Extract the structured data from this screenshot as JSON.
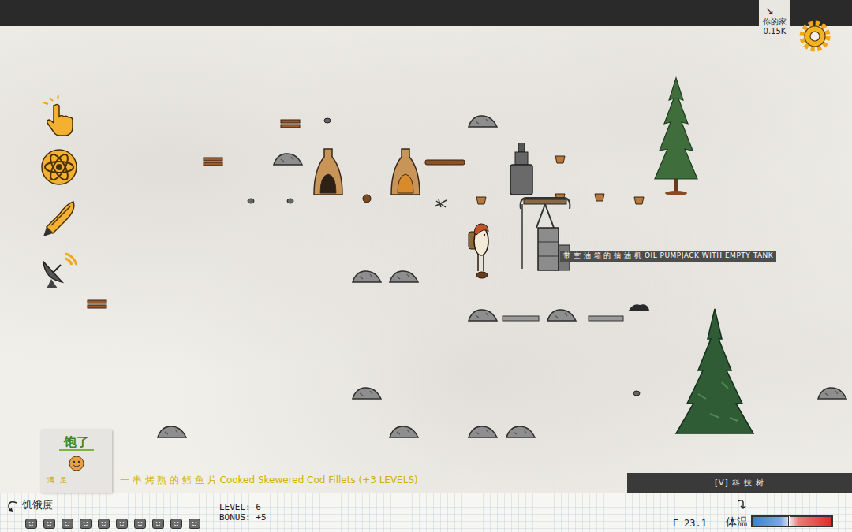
{
  "top_bar": {
    "home": {
      "arrow": "↘",
      "label": "你的家",
      "distance": "0.15K"
    }
  },
  "world": {
    "tooltip": "带 空 油 箱 的 抽 油 机 OIL PUMPJACK WITH EMPTY TANK"
  },
  "status_card": {
    "title": "饱了",
    "subtitle": "满 足"
  },
  "message": "一 串 烤 熟 的 鳕 鱼 片 Cooked Skewered Cod Fillets (+3 LEVELS)",
  "tech_tree_button": "[V] 科 技 树",
  "hud": {
    "hunger": {
      "label": "饥饿度",
      "pips": [
        {
          "filled": true
        },
        {
          "filled": true
        },
        {
          "filled": true
        },
        {
          "filled": true
        },
        {
          "filled": true
        },
        {
          "filled": true
        },
        {
          "filled": true
        },
        {
          "filled": true
        },
        {
          "filled": true
        },
        {
          "filled": true
        }
      ]
    },
    "level": "LEVEL: 6",
    "bonus": "BONUS: +5",
    "temperature": {
      "reading": "F 23.1",
      "label": "体温",
      "level": 0.47
    }
  }
}
